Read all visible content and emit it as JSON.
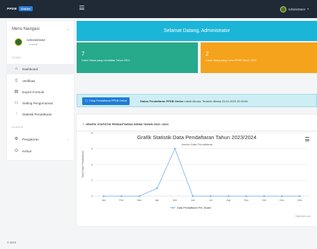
{
  "navbar": {
    "brand": "PPDB",
    "brand_badge": "Online",
    "user_name": "Administrator",
    "caret": "▾"
  },
  "sidebar": {
    "header": "Menu Navigasi",
    "user": {
      "name": "Administrator",
      "role": "admin"
    },
    "sections": {
      "main": "UTAMA",
      "other": "LAINNYA"
    },
    "items": [
      {
        "label": "Dashboard",
        "icon": "home-icon",
        "glyph": "⌂"
      },
      {
        "label": "Verifikasi",
        "icon": "file-check-icon",
        "glyph": "▯"
      },
      {
        "label": "Export Formulir",
        "icon": "file-export-icon",
        "glyph": "▤"
      },
      {
        "label": "Setting Pengumuman",
        "icon": "file-settings-icon",
        "glyph": "▭"
      },
      {
        "label": "Statistik Pendaftaran",
        "icon": "chart-icon",
        "glyph": "⫶"
      },
      {
        "label": "Pengaturan",
        "icon": "gear-icon",
        "glyph": "⚙"
      },
      {
        "label": "Keluar",
        "icon": "power-icon",
        "glyph": "⏻"
      }
    ]
  },
  "welcome": "Selamat Datang, Administrator",
  "stats": {
    "green": {
      "value": "7",
      "desc": "Calon Siswa yang mendaftar Tahun 2023"
    },
    "orange": {
      "value": "2",
      "desc": "Calon Siswa yang Lolos PPDB Tahun 2023"
    }
  },
  "info": {
    "button": "Tutup Pendaftaran PPDB Online",
    "bold": "Status Pendaftaran PPDB Online",
    "text": "masih dibuka. Terakhir dibuka 23-02-2023 20:20:54."
  },
  "chart_card": {
    "header": "GRAFIK STATISTIK PENDAFTARAN SISWA TAHUN 2023 / 2024",
    "credits": "Highcharts.com"
  },
  "footer": "© 2023",
  "colors": {
    "navbar": "#1f2a36",
    "welcome": "#1bb5d8",
    "stat_green": "#27a98c",
    "stat_orange": "#f5a21c",
    "line": "#7cb5ec"
  },
  "chart_data": {
    "type": "line",
    "title": "Grafik Statistik Data Pendaftaran Tahun 2023/2024",
    "subtitle": "Jumlah Data Pendaftaran",
    "xlabel": "",
    "ylabel": "Total Data Pendaftaran",
    "categories": [
      "Jan",
      "Feb",
      "Mar",
      "Apr",
      "Mei",
      "Jun",
      "Jul",
      "Agt",
      "Sep",
      "Okt",
      "Nov",
      "Des"
    ],
    "yticks": [
      0,
      2,
      4,
      6,
      8
    ],
    "ylim": [
      0,
      8
    ],
    "series": [
      {
        "name": "Data Pendaftaran Per- Bulan",
        "values": [
          0,
          0,
          0,
          1,
          6,
          0,
          0,
          0,
          0,
          0,
          0,
          0
        ]
      }
    ],
    "legend": "bottom",
    "grid": true
  }
}
